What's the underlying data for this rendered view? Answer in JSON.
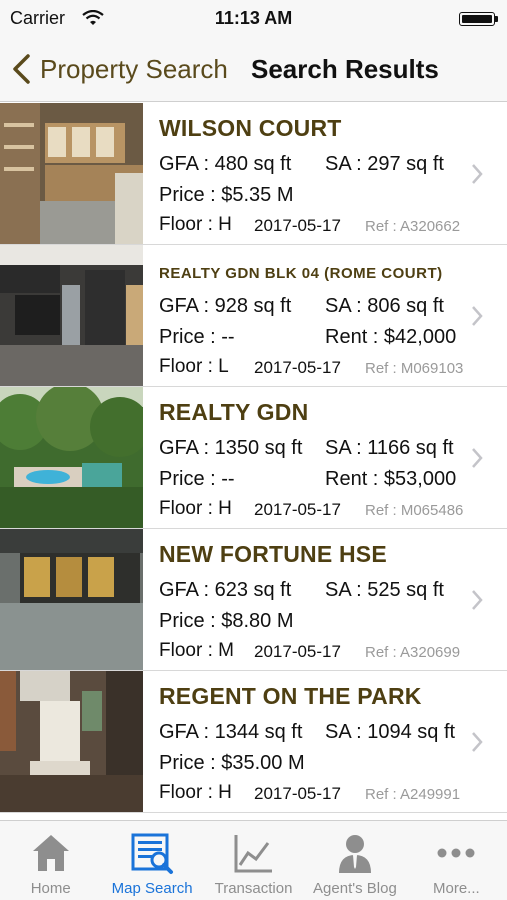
{
  "status_bar": {
    "carrier": "Carrier",
    "time": "11:13 AM"
  },
  "nav": {
    "back_label": "Property Search",
    "title": "Search Results"
  },
  "results": [
    {
      "title": "WILSON COURT",
      "gfa": "GFA : 480 sq ft",
      "sa": "SA : 297 sq ft",
      "price": "Price : $5.35 M",
      "rent": "",
      "floor": "Floor : H",
      "date": "2017-05-17",
      "ref": "Ref : A320662"
    },
    {
      "title": "REALTY GDN BLK 04 (ROME COURT)",
      "gfa": "GFA : 928 sq ft",
      "sa": "SA : 806 sq ft",
      "price": "Price : --",
      "rent": "Rent : $42,000",
      "floor": "Floor : L",
      "date": "2017-05-17",
      "ref": "Ref : M069103"
    },
    {
      "title": "REALTY GDN",
      "gfa": "GFA : 1350 sq ft",
      "sa": "SA : 1166 sq ft",
      "price": "Price : --",
      "rent": "Rent : $53,000",
      "floor": "Floor : H",
      "date": "2017-05-17",
      "ref": "Ref : M065486"
    },
    {
      "title": "NEW FORTUNE HSE",
      "gfa": "GFA : 623 sq ft",
      "sa": "SA : 525 sq ft",
      "price": "Price : $8.80 M",
      "rent": "",
      "floor": "Floor : M",
      "date": "2017-05-17",
      "ref": "Ref : A320699"
    },
    {
      "title": "REGENT ON THE PARK",
      "gfa": "GFA : 1344 sq ft",
      "sa": "SA : 1094 sq ft",
      "price": "Price : $35.00 M",
      "rent": "",
      "floor": "Floor : H",
      "date": "2017-05-17",
      "ref": "Ref : A249991"
    }
  ],
  "tabs": [
    {
      "label": "Home",
      "icon": "home-icon"
    },
    {
      "label": "Map Search",
      "icon": "map-search-icon"
    },
    {
      "label": "Transaction",
      "icon": "line-chart-icon"
    },
    {
      "label": "Agent's Blog",
      "icon": "agent-icon"
    },
    {
      "label": "More...",
      "icon": "more-icon"
    }
  ],
  "colors": {
    "title_brown": "#4e3f12",
    "tab_active": "#1a73d9",
    "tab_inactive": "#8e8e8e"
  }
}
